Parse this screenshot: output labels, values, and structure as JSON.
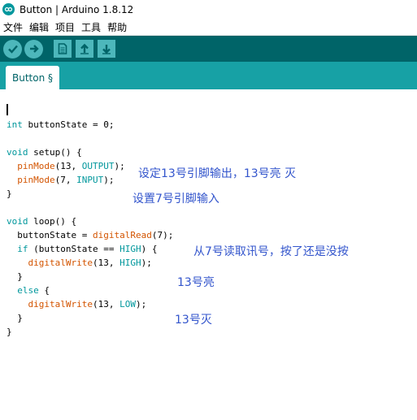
{
  "window": {
    "title": "Button | Arduino 1.8.12"
  },
  "menu": {
    "items": [
      "文件",
      "编辑",
      "项目",
      "工具",
      "帮助"
    ]
  },
  "toolbar": {
    "verify_icon": "check-icon",
    "upload_icon": "arrow-right-icon",
    "new_icon": "document-icon",
    "open_icon": "arrow-up-icon",
    "save_icon": "arrow-down-icon"
  },
  "tabs": [
    {
      "label": "Button §"
    }
  ],
  "code": {
    "lines": [
      [
        {
          "t": "int",
          "c": "kw"
        },
        {
          "t": " buttonState = 0;"
        }
      ],
      [],
      [
        {
          "t": "void",
          "c": "kw"
        },
        {
          "t": " setup() {"
        }
      ],
      [
        {
          "t": "  "
        },
        {
          "t": "pinMode",
          "c": "fn"
        },
        {
          "t": "(13, "
        },
        {
          "t": "OUTPUT",
          "c": "const"
        },
        {
          "t": ");"
        }
      ],
      [
        {
          "t": "  "
        },
        {
          "t": "pinMode",
          "c": "fn"
        },
        {
          "t": "(7, "
        },
        {
          "t": "INPUT",
          "c": "const"
        },
        {
          "t": ");"
        }
      ],
      [
        {
          "t": "}"
        }
      ],
      [],
      [
        {
          "t": "void",
          "c": "kw"
        },
        {
          "t": " loop() {"
        }
      ],
      [
        {
          "t": "  buttonState = "
        },
        {
          "t": "digitalRead",
          "c": "fn"
        },
        {
          "t": "(7);"
        }
      ],
      [
        {
          "t": "  "
        },
        {
          "t": "if",
          "c": "kw"
        },
        {
          "t": " (buttonState == "
        },
        {
          "t": "HIGH",
          "c": "const"
        },
        {
          "t": ") {"
        }
      ],
      [
        {
          "t": "    "
        },
        {
          "t": "digitalWrite",
          "c": "fn"
        },
        {
          "t": "(13, "
        },
        {
          "t": "HIGH",
          "c": "const"
        },
        {
          "t": ");"
        }
      ],
      [
        {
          "t": "  }"
        }
      ],
      [
        {
          "t": "  "
        },
        {
          "t": "else",
          "c": "kw"
        },
        {
          "t": " {"
        }
      ],
      [
        {
          "t": "    "
        },
        {
          "t": "digitalWrite",
          "c": "fn"
        },
        {
          "t": "(13, "
        },
        {
          "t": "LOW",
          "c": "const"
        },
        {
          "t": ");"
        }
      ],
      [
        {
          "t": "  }"
        }
      ],
      [
        {
          "t": "}"
        }
      ]
    ]
  },
  "annotations": {
    "note1": "设定13号引脚输出，13号亮 灭",
    "note2": "设置7号引脚输入",
    "note3": "从7号读取讯号，按了还是没按",
    "note4": "13号亮",
    "note5": "13号灭"
  },
  "colors": {
    "toolbar": "#006468",
    "tabbar": "#17a1a5",
    "button": "#4db7bb",
    "keyword": "#00979c",
    "function": "#d35400",
    "annotation": "#3355cc"
  }
}
